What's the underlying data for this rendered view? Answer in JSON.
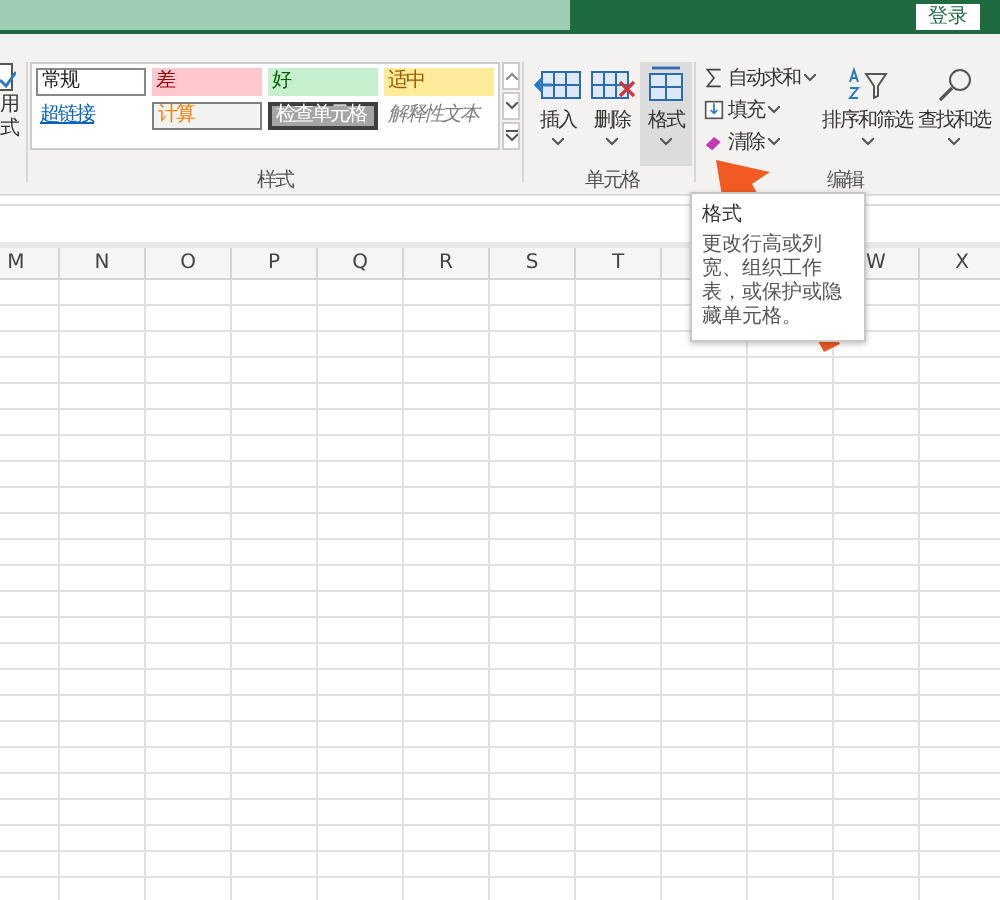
{
  "title_bar": {
    "login_button": "登录"
  },
  "ribbon": {
    "partial_group": {
      "lines": [
        "用",
        "式"
      ]
    },
    "styles_group": {
      "label": "样式",
      "cells": [
        {
          "text": "常规",
          "kind": "normal"
        },
        {
          "text": "差",
          "kind": "bad"
        },
        {
          "text": "好",
          "kind": "good"
        },
        {
          "text": "适中",
          "kind": "neutral"
        },
        {
          "text": "超链接",
          "kind": "hyperlink"
        },
        {
          "text": "计算",
          "kind": "calculation"
        },
        {
          "text": "检查单元格",
          "kind": "check"
        },
        {
          "text": "解释性文本",
          "kind": "explanatory"
        }
      ]
    },
    "cells_group": {
      "label": "单元格",
      "buttons": [
        {
          "label": "插入",
          "kind": "insert",
          "hovered": false
        },
        {
          "label": "删除",
          "kind": "delete",
          "hovered": false
        },
        {
          "label": "格式",
          "kind": "format",
          "hovered": true
        }
      ]
    },
    "editing_group": {
      "label": "编辑",
      "small_buttons": [
        {
          "label": "自动求和",
          "kind": "sum"
        },
        {
          "label": "填充",
          "kind": "fill"
        },
        {
          "label": "清除",
          "kind": "clear"
        }
      ],
      "large_buttons": [
        {
          "label": "排序和筛选",
          "kind": "sort"
        },
        {
          "label": "查找和选",
          "kind": "find"
        }
      ]
    }
  },
  "tooltip": {
    "title": "格式",
    "text": "更改行高或列宽、组织工作表，或保护或隐藏单元格。"
  },
  "sheet": {
    "columns": [
      {
        "label": "M"
      },
      {
        "label": "N"
      },
      {
        "label": "O"
      },
      {
        "label": "P"
      },
      {
        "label": "Q"
      },
      {
        "label": "R"
      },
      {
        "label": "S"
      },
      {
        "label": "T"
      },
      {
        "label": "W"
      },
      {
        "label": "X"
      }
    ]
  }
}
